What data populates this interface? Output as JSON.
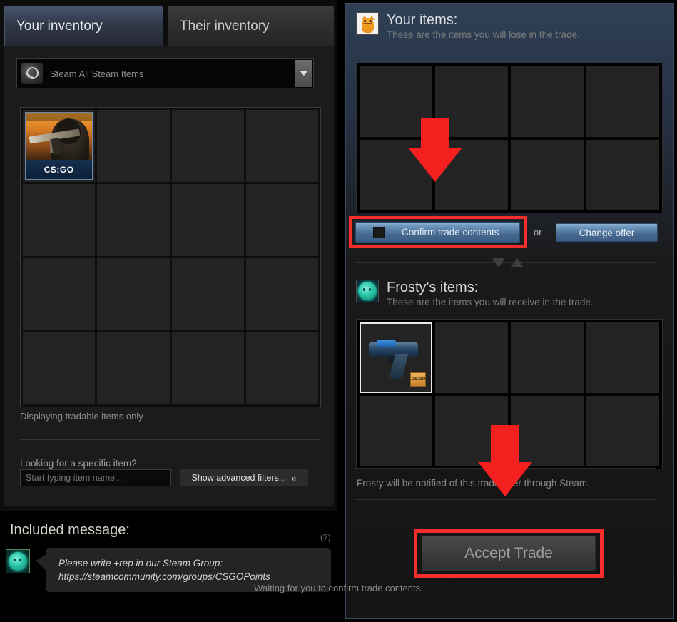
{
  "left": {
    "tabs": [
      {
        "label": "Your inventory",
        "active": true
      },
      {
        "label": "Their inventory",
        "active": false
      }
    ],
    "app_filter": {
      "label": "Steam All Steam Items",
      "icon": "steam-icon",
      "dropdown_icon": "chevron-down-icon"
    },
    "inventory": {
      "columns": 4,
      "rows": 4,
      "items": [
        {
          "slot": 0,
          "name": "CS:GO Trading Card",
          "game": "CS:GO",
          "type": "trading-card"
        }
      ]
    },
    "tradable_note": "Displaying tradable items only",
    "search": {
      "label": "Looking for a specific item?",
      "placeholder": "Start typing item name...",
      "value": ""
    },
    "advanced_filters_label": "Show advanced filters...",
    "advanced_filters_icon": "chevron-double-down-icon"
  },
  "message": {
    "title": "Included message:",
    "help": "(?)",
    "avatar": "frosty-avatar",
    "lines": [
      "Please write +rep in our Steam Group:",
      "https://steamcommunity.com/groups/CSGOPoints"
    ]
  },
  "right": {
    "your_items": {
      "avatar": "cat-avatar",
      "title": "Your items:",
      "subtitle": "These are the items you will lose in the trade.",
      "columns": 4,
      "rows": 2,
      "items": []
    },
    "confirm": {
      "button_label": "Confirm trade contents",
      "checkbox_checked": false,
      "or_label": "or",
      "change_offer_label": "Change offer",
      "highlighted": true,
      "highlight_color": "#f42d2d"
    },
    "swap_icons": [
      "arrow-down-icon",
      "arrow-up-icon"
    ],
    "their_items": {
      "avatar": "frosty-avatar",
      "title": "Frosty's items:",
      "subtitle": "These are the items you will receive in the trade.",
      "columns": 4,
      "rows": 2,
      "items": [
        {
          "slot": 0,
          "name": "CS:GO Pistol Skin",
          "game_badge": "CS:GO",
          "selected": true
        }
      ]
    },
    "notify_text": "Frosty will be notified of this trade offer through Steam.",
    "accept": {
      "label": "Accept Trade",
      "disabled": true,
      "highlighted": true,
      "highlight_color": "#f42d2d"
    },
    "status_text": "Waiting for you to confirm trade contents."
  },
  "annotations": {
    "arrow_color": "#f42020",
    "arrows": [
      {
        "name": "arrow-to-confirm-button",
        "points_to": "Confirm trade contents"
      },
      {
        "name": "arrow-to-accept-button",
        "points_to": "Accept Trade"
      }
    ]
  }
}
